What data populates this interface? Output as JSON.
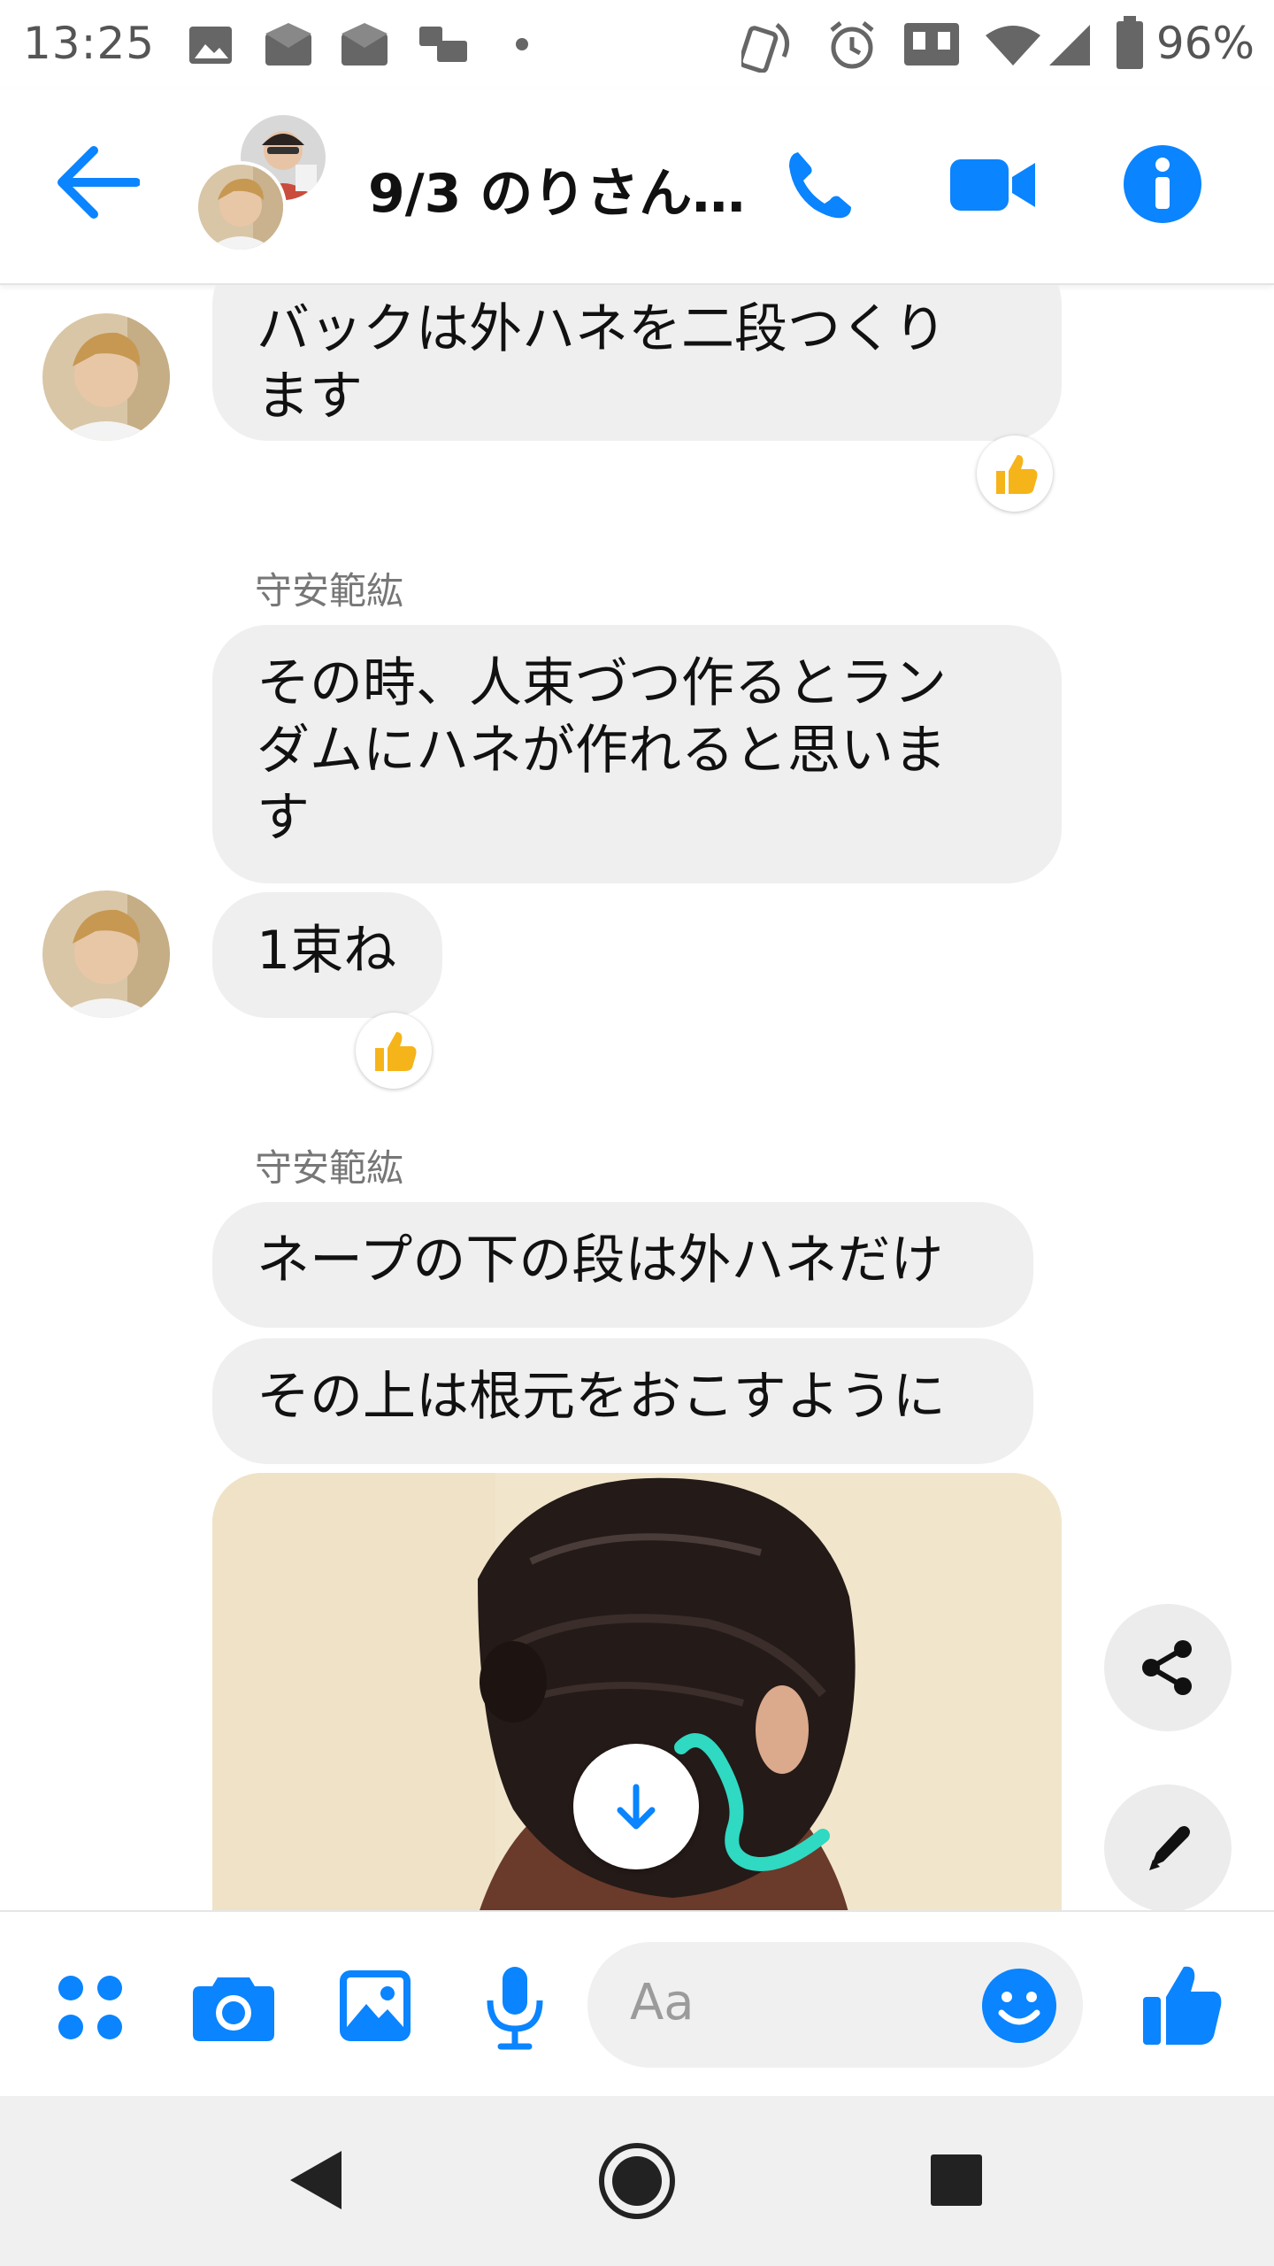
{
  "status_bar": {
    "time": "13:25",
    "battery_percent": "96%",
    "icons": [
      "image-icon",
      "mail-icon",
      "mail-icon",
      "voicemail-icon",
      "dot-icon",
      "nfc-icon",
      "alarm-icon",
      "vibrate-icon",
      "wifi-icon",
      "signal-icon",
      "battery-icon"
    ]
  },
  "header": {
    "title": "9/3 のりさん…",
    "icons": [
      "back-arrow-icon",
      "phone-icon",
      "video-camera-icon",
      "info-icon"
    ]
  },
  "messages": [
    {
      "text_lines": [
        "バックは外ハネを二段つくり",
        "ます"
      ],
      "reaction": "thumbs-up"
    },
    {
      "sender": "守安範紘",
      "text_lines": [
        "その時、人束づつ作るとラン",
        "ダムにハネが作れると思いま",
        "す"
      ]
    },
    {
      "text_lines": [
        "1束ね"
      ],
      "reaction": "thumbs-up"
    },
    {
      "sender": "守安範紘",
      "text_lines": [
        "ネープの下の段は外ハネだけ"
      ]
    },
    {
      "text_lines": [
        "その上は根元をおこすように"
      ]
    }
  ],
  "composer": {
    "placeholder": "Aa",
    "icons": [
      "apps-icon",
      "camera-icon",
      "gallery-icon",
      "microphone-icon",
      "emoji-icon",
      "thumbs-up-icon"
    ]
  },
  "colors": {
    "accent": "#0a84ff",
    "bubble": "#efefef",
    "reaction": "#f6b41b",
    "annotation": "#2fd9c2"
  }
}
